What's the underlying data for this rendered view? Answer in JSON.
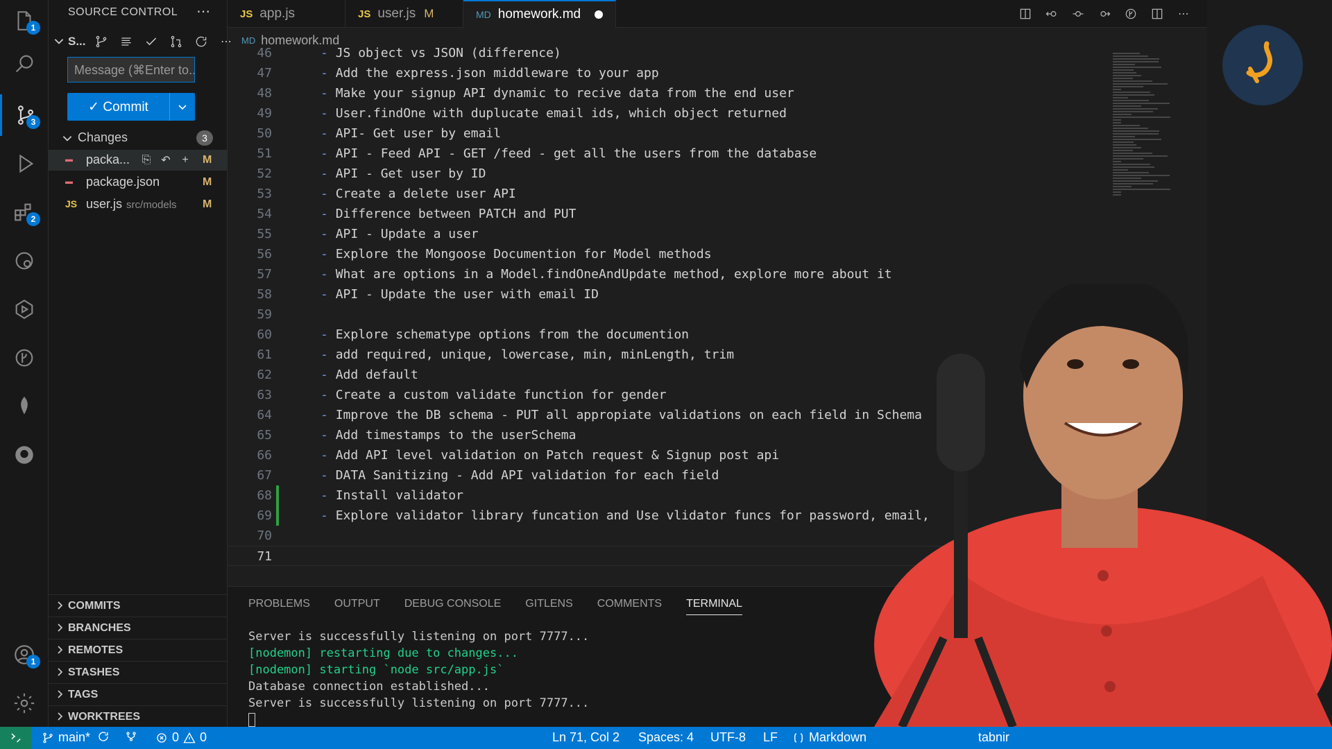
{
  "activity_bar": {
    "explorer_badge": "1",
    "scm_badge": "3",
    "extensions_badge": "2",
    "accounts_badge": "1"
  },
  "sidebar": {
    "title": "SOURCE CONTROL",
    "scm_repo_label": "S...",
    "message_placeholder": "Message (⌘Enter to...",
    "commit_label": "✓ Commit",
    "changes_label": "Changes",
    "changes_count": "3",
    "files": [
      {
        "name": "packa...",
        "path": "",
        "status": "M"
      },
      {
        "name": "package.json",
        "path": "",
        "status": "M"
      },
      {
        "name": "user.js",
        "path": "src/models",
        "status": "M"
      }
    ],
    "sections": [
      "COMMITS",
      "BRANCHES",
      "REMOTES",
      "STASHES",
      "TAGS",
      "WORKTREES"
    ]
  },
  "tabs": [
    {
      "icon": "JS",
      "label": "app.js",
      "modified": ""
    },
    {
      "icon": "JS",
      "label": "user.js",
      "modified": "M"
    },
    {
      "icon": "MD",
      "label": "homework.md",
      "modified": "●"
    }
  ],
  "breadcrumb": "homework.md",
  "editor": {
    "lines": [
      {
        "n": "46",
        "text": "JS object vs JSON (difference)"
      },
      {
        "n": "47",
        "text": "Add the express.json middleware to your app"
      },
      {
        "n": "48",
        "text": "Make your signup API dynamic to recive data from the end user"
      },
      {
        "n": "49",
        "text": "User.findOne with duplucate email ids, which object returned"
      },
      {
        "n": "50",
        "text": "API- Get user by email"
      },
      {
        "n": "51",
        "text": "API - Feed API - GET /feed - get all the users from the database"
      },
      {
        "n": "52",
        "text": "API - Get user by ID"
      },
      {
        "n": "53",
        "text": "Create a delete user API"
      },
      {
        "n": "54",
        "text": "Difference between PATCH and PUT"
      },
      {
        "n": "55",
        "text": "API - Update a user"
      },
      {
        "n": "56",
        "text": "Explore the Mongoose Documention for Model methods"
      },
      {
        "n": "57",
        "text": "What are options in a Model.findOneAndUpdate method, explore more about it"
      },
      {
        "n": "58",
        "text": "API - Update the user with email ID"
      },
      {
        "n": "59",
        "text": ""
      },
      {
        "n": "60",
        "text": "Explore schematype options from the documention"
      },
      {
        "n": "61",
        "text": "add required, unique, lowercase, min, minLength, trim"
      },
      {
        "n": "62",
        "text": "Add default"
      },
      {
        "n": "63",
        "text": "Create a custom validate function for gender"
      },
      {
        "n": "64",
        "text": "Improve the DB schema - PUT all appropiate validations on each field in Schema"
      },
      {
        "n": "65",
        "text": "Add timestamps to the userSchema"
      },
      {
        "n": "66",
        "text": "Add API level validation on Patch request & Signup post api"
      },
      {
        "n": "67",
        "text": "DATA Sanitizing - Add API validation for each field"
      },
      {
        "n": "68",
        "text": "Install validator"
      },
      {
        "n": "69",
        "text": "Explore validator library funcation and Use vlidator funcs for password, email,"
      },
      {
        "n": "70",
        "text": ""
      },
      {
        "n": "71",
        "text": ""
      }
    ]
  },
  "panel": {
    "tabs": [
      "PROBLEMS",
      "OUTPUT",
      "DEBUG CONSOLE",
      "GITLENS",
      "COMMENTS",
      "TERMINAL"
    ],
    "terminal": {
      "line1": "Server is successfully listening on port 7777...",
      "line2": "[nodemon] restarting due to changes...",
      "line3": "[nodemon] starting `node src/app.js`",
      "line4": "Database connection established...",
      "line5": "Server is successfully listening on port 7777..."
    }
  },
  "status_bar": {
    "branch": "main*",
    "errors": "0",
    "warnings": "0",
    "position": "Ln 71, Col 2",
    "spaces": "Spaces: 4",
    "encoding": "UTF-8",
    "eol": "LF",
    "language": "Markdown",
    "tabnine": "tabnir"
  },
  "colors": {
    "accent": "#0078d4",
    "modified": "#d8b36c",
    "added": "#2ea043",
    "shirt": "#e5423a"
  }
}
